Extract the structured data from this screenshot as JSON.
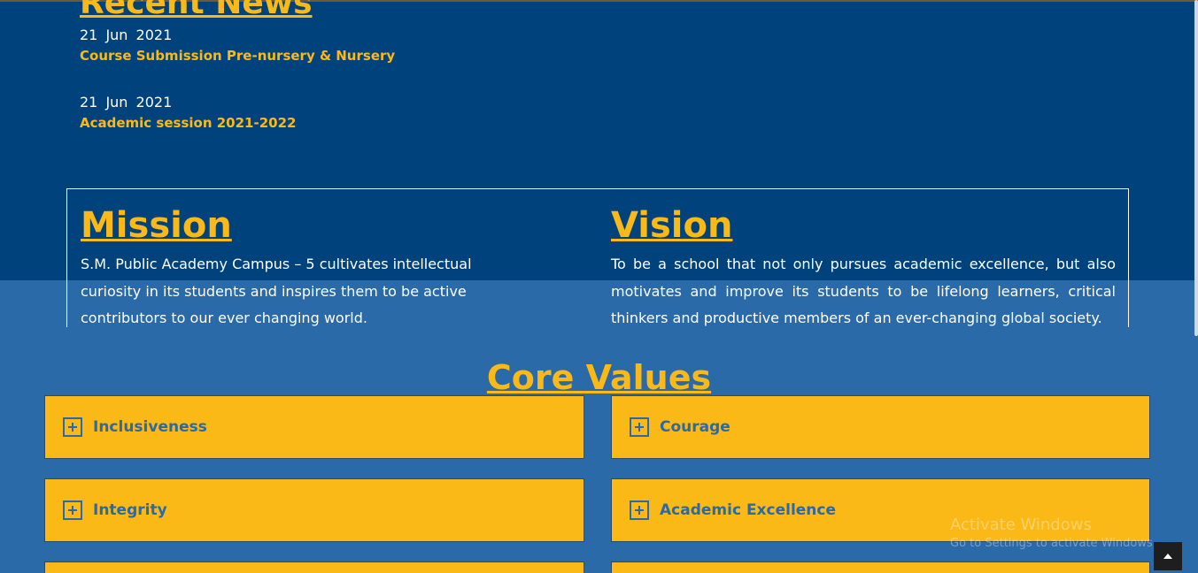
{
  "recent_news": {
    "title": "Recent News",
    "items": [
      {
        "date": "21 Jun 2021",
        "title": "Course Submission Pre-nursery & Nursery"
      },
      {
        "date": "21 Jun 2021",
        "title": "Academic session 2021-2022"
      }
    ]
  },
  "mission": {
    "heading": "Mission",
    "text": "S.M. Public Academy Campus – 5 cultivates intellectual curiosity in its students and inspires them to be active contributors to our ever changing world."
  },
  "vision": {
    "heading": "Vision",
    "text": "To be a school that not only pursues academic excellence, but also motivates and improve its students to be lifelong learners, critical thinkers and productive members of an ever-changing global society."
  },
  "core_values": {
    "title": "Core Values",
    "items": [
      {
        "label": "Inclusiveness"
      },
      {
        "label": "Courage"
      },
      {
        "label": "Integrity"
      },
      {
        "label": "Academic Excellence"
      }
    ]
  },
  "watermark": {
    "title": "Activate Windows",
    "subtitle": "Go to Settings to activate Windows."
  },
  "colors": {
    "dark_blue": "#00437c",
    "mid_blue": "#2a6aa8",
    "accent_yellow": "#fbb917"
  }
}
